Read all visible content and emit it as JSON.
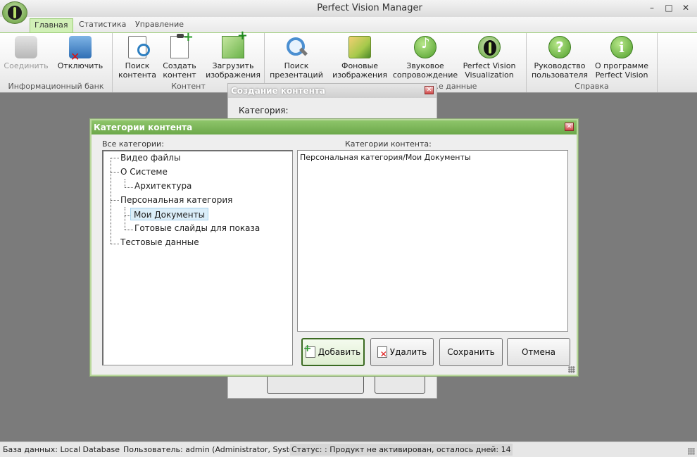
{
  "window": {
    "title": "Perfect Vision Manager",
    "minimize": "–",
    "maximize": "□",
    "close": "✕"
  },
  "tabs": [
    {
      "label": "Главная",
      "active": true
    },
    {
      "label": "Статистика",
      "active": false
    },
    {
      "label": "Управление",
      "active": false
    }
  ],
  "ribbon": {
    "groups": [
      {
        "label": "Информационный банк",
        "buttons": [
          {
            "label": "Соединить",
            "disabled": true,
            "icon": "database-icon"
          },
          {
            "label": "Отключить",
            "disabled": false,
            "icon": "disconnect-icon"
          }
        ]
      },
      {
        "label": "Контент",
        "buttons": [
          {
            "label": "Поиск контента",
            "icon": "search-content-icon"
          },
          {
            "label": "Создать контент",
            "icon": "create-content-icon"
          },
          {
            "label": "Загрузить изображения",
            "icon": "upload-images-icon"
          }
        ]
      },
      {
        "label": "…е данные",
        "buttons": [
          {
            "label": "Поиск презентаций",
            "icon": "search-icon"
          },
          {
            "label": "Фоновые изображения",
            "icon": "background-images-icon"
          },
          {
            "label": "Звуковое сопровождение",
            "icon": "music-icon"
          },
          {
            "label": "Perfect Vision Visualization",
            "icon": "pv-logo-icon"
          }
        ]
      },
      {
        "label": "Справка",
        "buttons": [
          {
            "label": "Руководство пользователя",
            "icon": "help-icon"
          },
          {
            "label": "О программе Perfect Vision",
            "icon": "info-icon"
          }
        ]
      }
    ]
  },
  "back_dialog": {
    "title": "Создание контента",
    "category_label": "Категория:"
  },
  "dialog": {
    "title": "Категории контента",
    "all_categories_label": "Все категории:",
    "content_categories_label": "Категории контента:",
    "tree": [
      {
        "label": "Видео файлы",
        "level": 0
      },
      {
        "label": "О Системе",
        "level": 0
      },
      {
        "label": "Архитектура",
        "level": 1
      },
      {
        "label": "Персональная категория",
        "level": 0
      },
      {
        "label": "Мои Документы",
        "level": 1,
        "selected": true
      },
      {
        "label": "Готовые слайды для показа",
        "level": 1
      },
      {
        "label": "Тестовые данные",
        "level": 0
      }
    ],
    "content_categories": [
      "Персональная категория/Мои Документы"
    ],
    "buttons": {
      "add": "Добавить",
      "delete": "Удалить",
      "save": "Сохранить",
      "cancel": "Отмена"
    }
  },
  "status": {
    "database": "База данных: Local Database",
    "user": "Пользователь: admin (Administrator, System).",
    "state": "Статус: : Продукт не активирован, осталось дней: 14"
  },
  "colors": {
    "accent": "#8ec56a",
    "tab_active": "#d1f0b7",
    "workspace": "#7b7b7b"
  }
}
